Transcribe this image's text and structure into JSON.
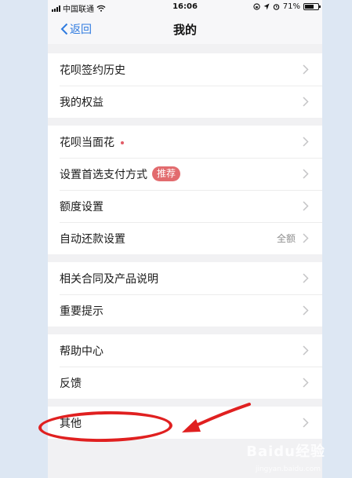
{
  "status_bar": {
    "carrier": "中国联通",
    "time": "16:06",
    "battery_percent": "71%",
    "battery_level": 0.71,
    "icons": [
      "signal-icon",
      "wifi-icon",
      "orientation-lock-icon",
      "location-icon",
      "alarm-icon",
      "battery-icon"
    ]
  },
  "nav": {
    "back_label": "返回",
    "title": "我的"
  },
  "groups": [
    {
      "rows": [
        {
          "label": "花呗签约历史"
        },
        {
          "label": "我的权益"
        }
      ]
    },
    {
      "rows": [
        {
          "label": "花呗当面花",
          "dot": true
        },
        {
          "label": "设置首选支付方式",
          "badge": "推荐"
        },
        {
          "label": "额度设置"
        },
        {
          "label": "自动还款设置",
          "value": "全额"
        }
      ]
    },
    {
      "rows": [
        {
          "label": "相关合同及产品说明"
        },
        {
          "label": "重要提示"
        }
      ]
    },
    {
      "rows": [
        {
          "label": "帮助中心"
        },
        {
          "label": "反馈"
        }
      ]
    },
    {
      "rows": [
        {
          "label": "其他"
        }
      ]
    }
  ],
  "colors": {
    "accent_link": "#2f7be0",
    "badge": "#e26b6e",
    "annotation": "#e02020"
  },
  "watermark": {
    "text": "Baidu经验",
    "sub": "jingyan.baidu.com"
  }
}
